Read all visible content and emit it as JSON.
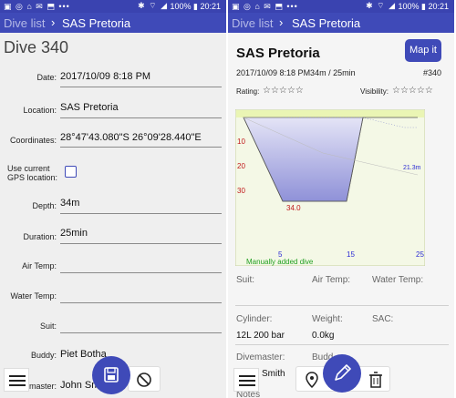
{
  "status_bar": {
    "battery": "100%",
    "time": "20:21"
  },
  "left": {
    "breadcrumb": {
      "parent": "Dive list",
      "current": "SAS Pretoria"
    },
    "form_title": "Dive 340",
    "fields": {
      "date": {
        "label": "Date:",
        "value": "2017/10/09 8:18 PM"
      },
      "location": {
        "label": "Location:",
        "value": "SAS Pretoria"
      },
      "coordinates": {
        "label": "Coordinates:",
        "value": "28°47'43.080\"S 26°09'28.440\"E"
      },
      "gps": {
        "label_line1": "Use current",
        "label_line2": "GPS location:",
        "checked": false
      },
      "depth": {
        "label": "Depth:",
        "value": "34m"
      },
      "duration": {
        "label": "Duration:",
        "value": "25min"
      },
      "air_temp": {
        "label": "Air Temp:",
        "value": ""
      },
      "water_temp": {
        "label": "Water Temp:",
        "value": ""
      },
      "suit": {
        "label": "Suit:",
        "value": ""
      },
      "buddy": {
        "label": "Buddy:",
        "value": "Piet Botha"
      },
      "divemaster": {
        "label": "master:",
        "value": "John Sm"
      }
    },
    "bottom_icons": {
      "menu": "menu-icon",
      "save": "save-icon",
      "cancel": "cancel-icon"
    }
  },
  "right": {
    "breadcrumb": {
      "parent": "Dive list",
      "current": "SAS Pretoria"
    },
    "title": "SAS Pretoria",
    "map_button": "Map it",
    "meta": "2017/10/09 8:18 PM34m / 25min",
    "dive_number": "#340",
    "rating_label": "Rating:",
    "visibility_label": "Visibility:",
    "rating_stars": "☆☆☆☆☆",
    "visibility_stars": "☆☆☆☆☆",
    "profile": {
      "depth_ticks": [
        "10",
        "20",
        "30"
      ],
      "time_ticks": [
        "5",
        "15",
        "25"
      ],
      "max_depth_label": "34.0",
      "temp_label": "21.3m",
      "note": "Manually added dive",
      "colors": {
        "fill": "#8f91d8",
        "max_label": "#c0181a",
        "ticks_y": "#c0181a",
        "ticks_x": "#2b2bd4",
        "note": "#22a022",
        "surface": "#e8f5a8"
      }
    },
    "info": {
      "suit_label": "Suit:",
      "air_label": "Air Temp:",
      "water_label": "Water Temp:",
      "cylinder_label": "Cylinder:",
      "cylinder_value": "12L 200 bar",
      "weight_label": "Weight:",
      "weight_value": "0.0kg",
      "sac_label": "SAC:",
      "divemaster_label": "Divemaster:",
      "divemaster_value": "Smith",
      "buddy_label": "Budd",
      "notes_label": "Notes"
    },
    "bottom_icons": {
      "menu": "menu-icon",
      "location": "location-pin-icon",
      "edit": "edit-icon",
      "delete": "trash-icon"
    }
  }
}
